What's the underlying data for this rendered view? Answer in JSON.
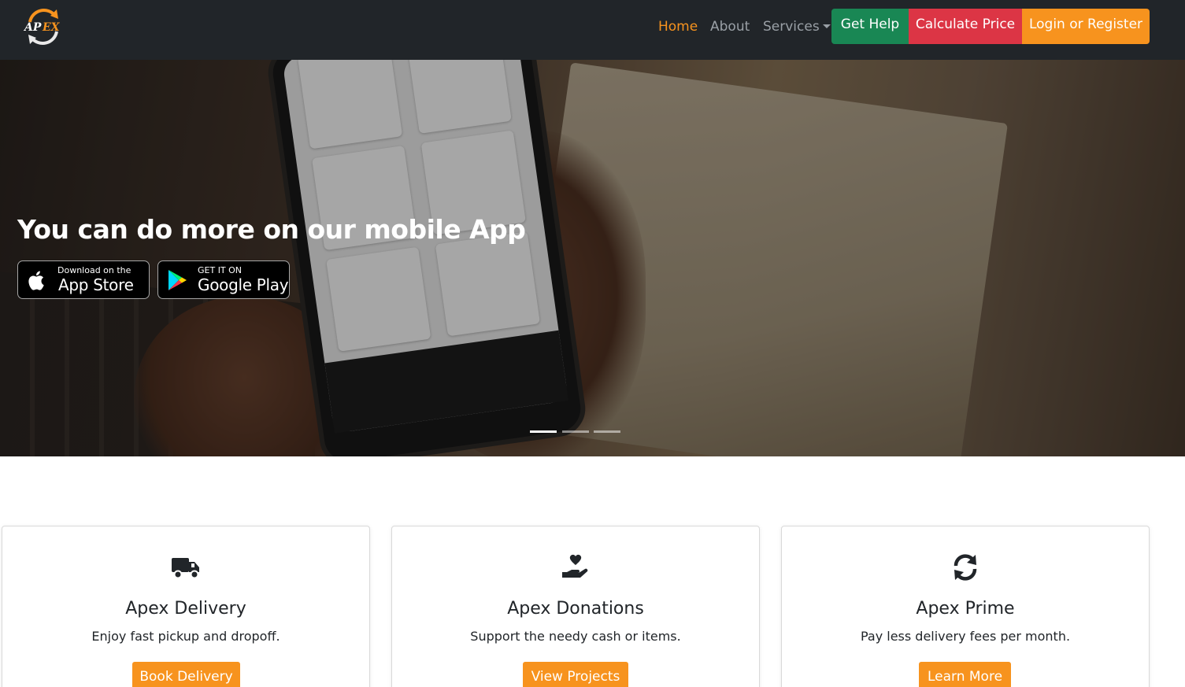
{
  "brand": {
    "logo_text": "APEX",
    "accent_color": "#f7931e"
  },
  "nav": {
    "home": "Home",
    "about": "About",
    "services": "Services",
    "get_help": "Get Help",
    "calculate_price": "Calculate Price",
    "login_register": "Login or Register"
  },
  "colors": {
    "navbar_bg": "#212529",
    "get_help": "#198754",
    "calculate_price": "#dc3545",
    "login_register": "#f7931e",
    "card_button": "#f7931e"
  },
  "hero": {
    "title": "You can do more on our mobile App",
    "app_store": {
      "small": "Download on the",
      "big": "App Store",
      "icon": "apple-icon"
    },
    "google_play": {
      "small": "GET IT ON",
      "big": "Google Play",
      "icon": "google-play-icon"
    },
    "active_slide": 1,
    "slide_count": 3
  },
  "cards": [
    {
      "icon": "truck-icon",
      "title": "Apex Delivery",
      "text": "Enjoy fast pickup and dropoff.",
      "button": "Book Delivery"
    },
    {
      "icon": "hand-holding-heart-icon",
      "title": "Apex Donations",
      "text": "Support the needy cash or items.",
      "button": "View Projects"
    },
    {
      "icon": "sync-icon",
      "title": "Apex Prime",
      "text": "Pay less delivery fees per month.",
      "button": "Learn More"
    }
  ]
}
